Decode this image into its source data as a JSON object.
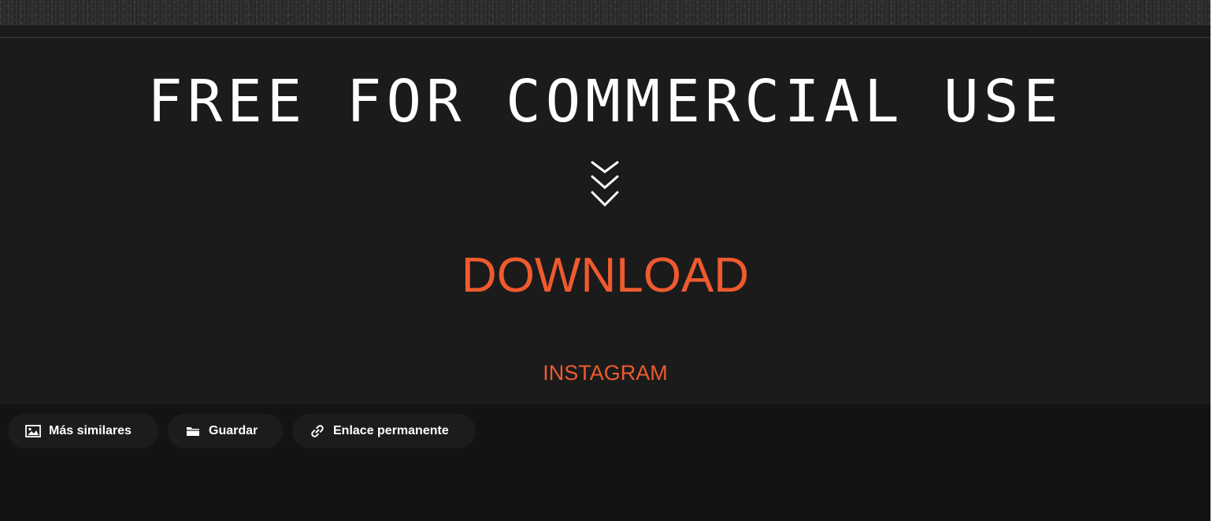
{
  "hero": {
    "title": "FREE FOR COMMERCIAL USE",
    "download_label": "DOWNLOAD",
    "instagram_label": "INSTAGRAM"
  },
  "actions": [
    {
      "label": "Más similares",
      "icon": "image-icon"
    },
    {
      "label": "Guardar",
      "icon": "folder-icon"
    },
    {
      "label": "Enlace permanente",
      "icon": "link-icon"
    }
  ],
  "colors": {
    "background": "#1b1b1b",
    "accent": "#ef5a2f",
    "action_bar": "#131313",
    "text": "#ffffff"
  }
}
